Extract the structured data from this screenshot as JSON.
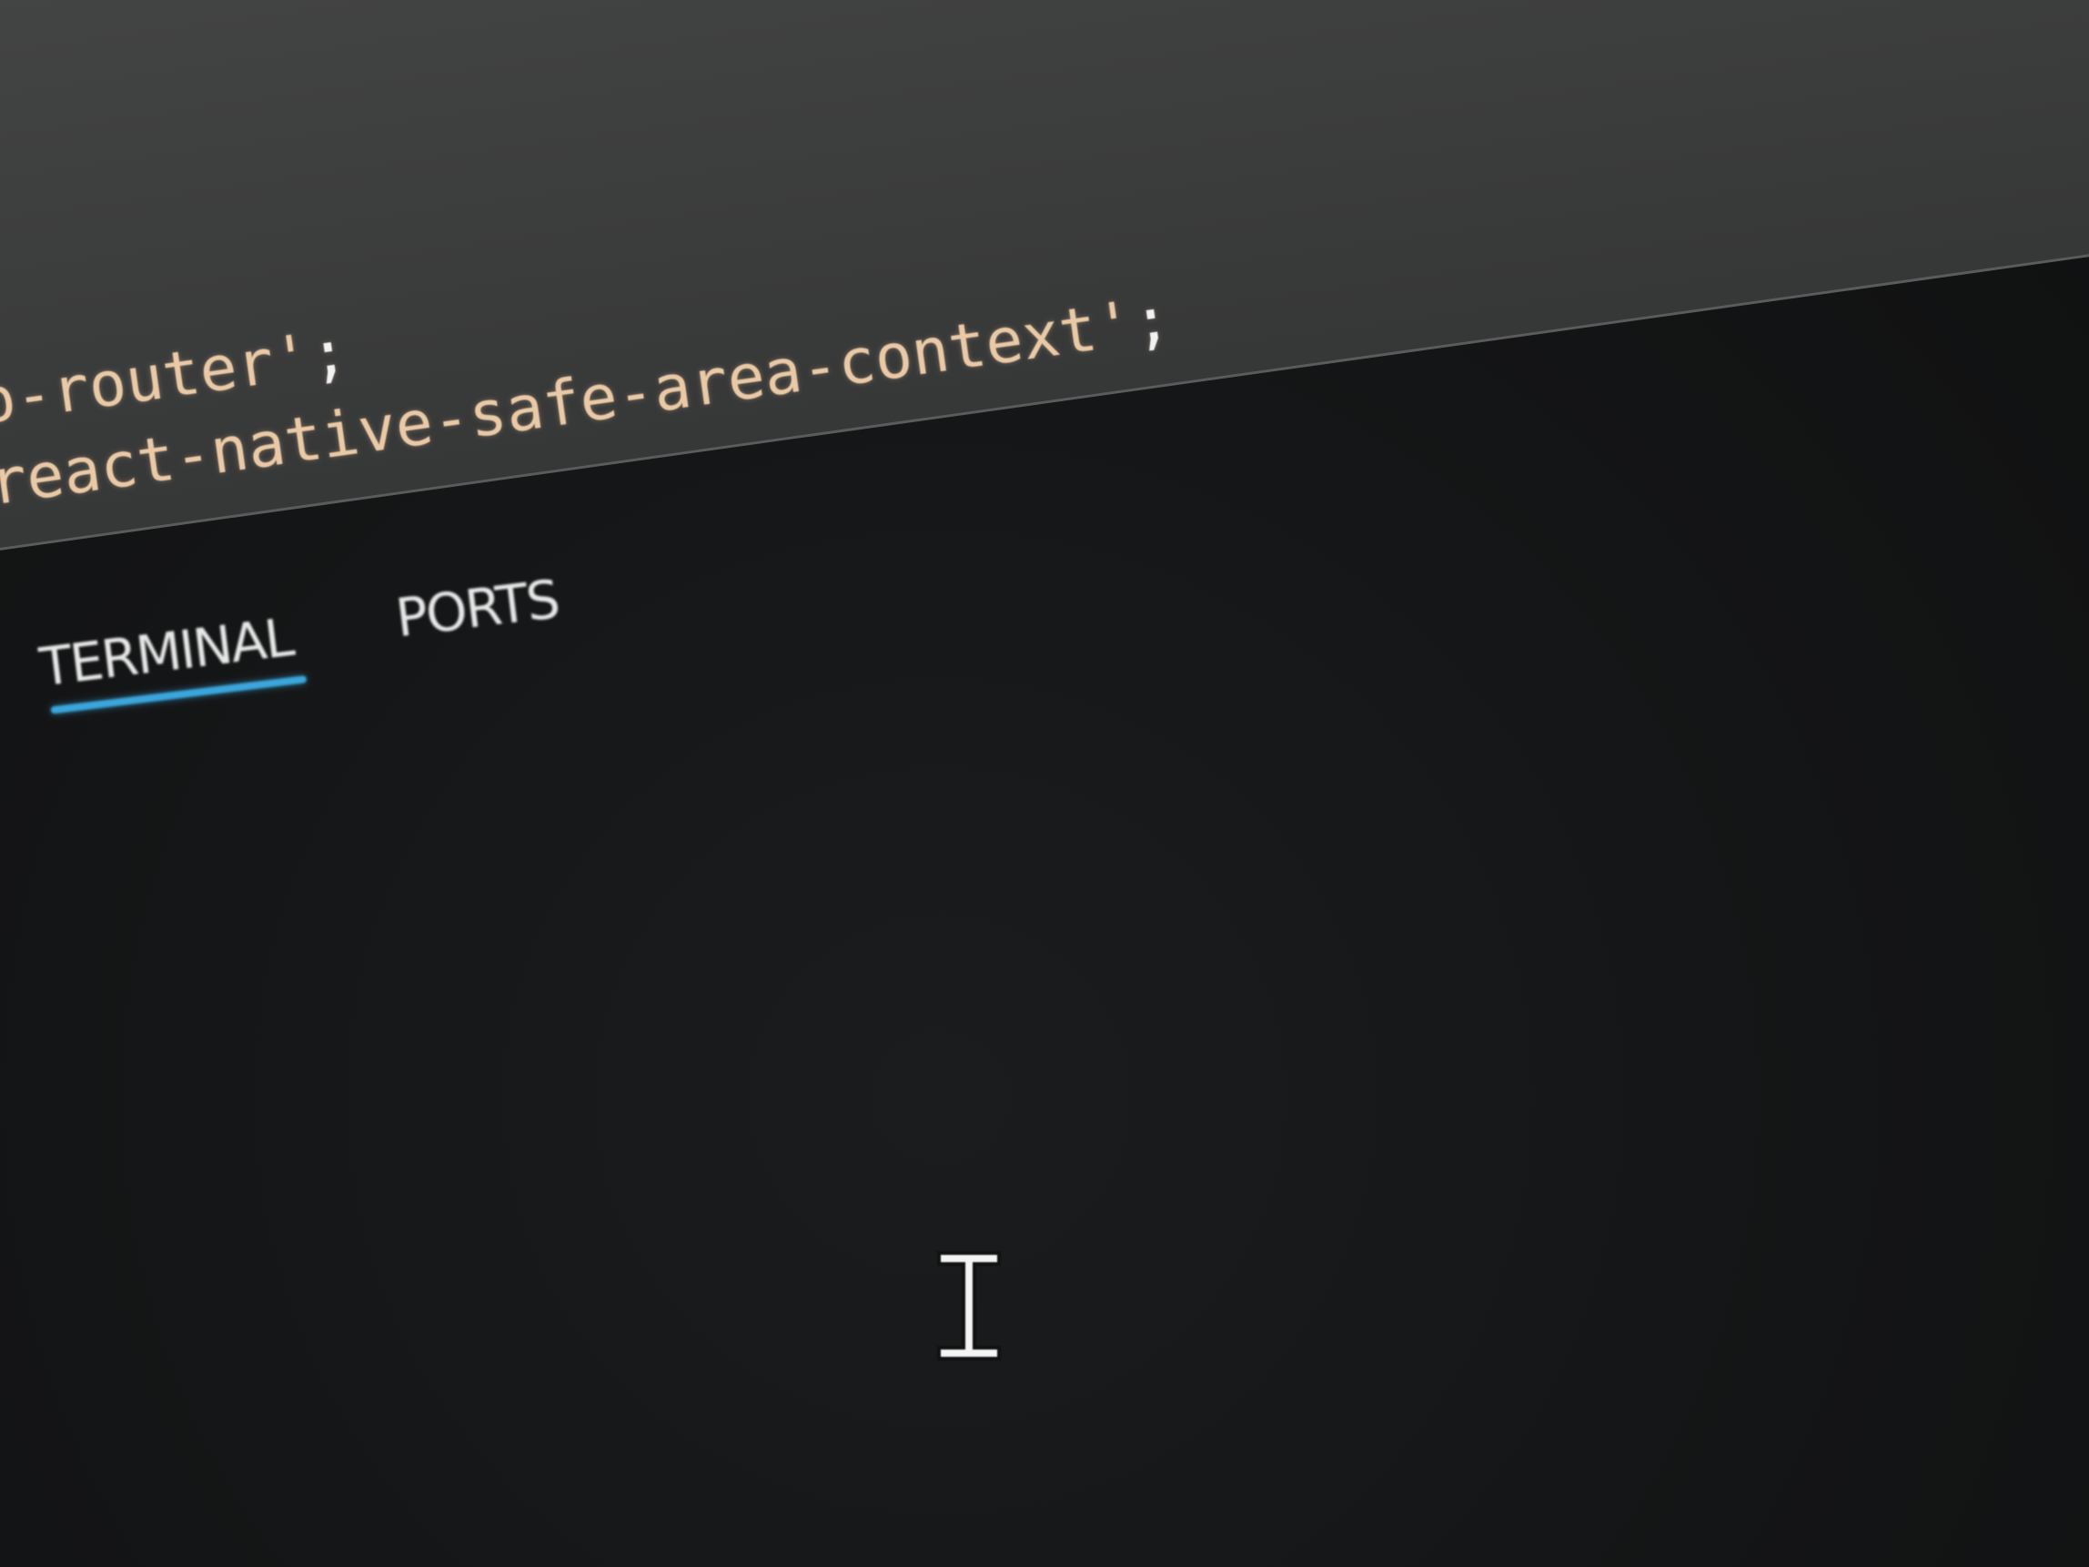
{
  "editor": {
    "lines": [
      {
        "text": "po-router'",
        "semicolon": ";"
      },
      {
        "text": "'react-native-safe-area-context'",
        "semicolon": ";"
      }
    ]
  },
  "panel": {
    "tabs": [
      {
        "label": "TERMINAL",
        "active": true
      },
      {
        "label": "PORTS",
        "active": false
      }
    ],
    "accent_color": "#3aa6dc"
  },
  "cursor": {
    "icon": "text-cursor-icon"
  }
}
